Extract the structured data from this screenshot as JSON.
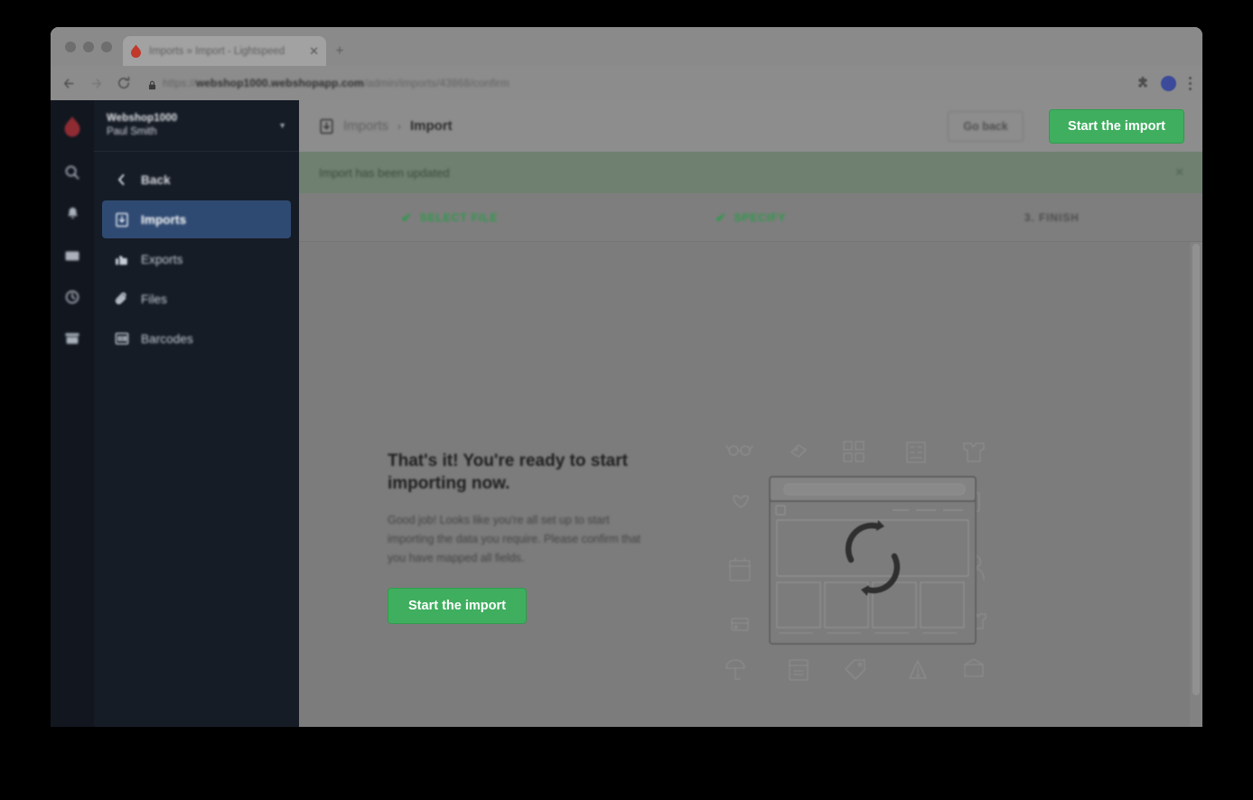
{
  "browser": {
    "tab": {
      "title": "Imports » Import - Lightspeed",
      "favicon_icon": "lightspeed-flame-icon",
      "close_icon": "close-icon"
    },
    "new_tab_label": "+",
    "nav": {
      "back_icon": "arrow-left-icon",
      "forward_icon": "arrow-right-icon",
      "reload_icon": "reload-icon"
    },
    "omnibox": {
      "lock_icon": "lock-icon",
      "url_scheme": "https://",
      "url_host": "webshop1000.webshopapp.com",
      "url_path": "/admin/imports/43868/confirm"
    },
    "toolbar_right": {
      "extension_icon": "puzzle-extension-icon",
      "profile_icon": "profile-avatar-icon",
      "menu_icon": "kebab-menu-icon"
    }
  },
  "sidebar": {
    "logo_icon": "lightspeed-flame-logo",
    "store": {
      "name": "Webshop1000",
      "user": "Paul Smith",
      "caret_icon": "chevron-down-icon"
    },
    "rail_items": [
      {
        "icon": "search-icon"
      },
      {
        "icon": "notification-bell-icon"
      },
      {
        "icon": "inbox-icon"
      },
      {
        "icon": "clock-history-icon"
      },
      {
        "icon": "archive-box-icon"
      }
    ],
    "nav_items": [
      {
        "label": "Back",
        "icon": "chevron-left-icon",
        "active": false
      },
      {
        "label": "Imports",
        "icon": "import-arrow-icon",
        "active": true
      },
      {
        "label": "Exports",
        "icon": "export-arrow-icon",
        "active": false
      },
      {
        "label": "Files",
        "icon": "paperclip-icon",
        "active": false
      },
      {
        "label": "Barcodes",
        "icon": "barcode-icon",
        "active": false
      }
    ]
  },
  "header": {
    "breadcrumb_icon": "import-arrow-icon",
    "breadcrumb_parent": "Imports",
    "breadcrumb_separator": "›",
    "breadcrumb_current": "Import",
    "go_back_label": "Go back",
    "start_import_label": "Start the import"
  },
  "alert": {
    "message": "Import has been updated",
    "close_icon": "close-icon"
  },
  "steps": [
    {
      "label": "SELECT FILE",
      "state": "done",
      "marker": "✔"
    },
    {
      "label": "SPECIFY",
      "state": "done",
      "marker": "✔"
    },
    {
      "label": "3. FINISH",
      "state": "todo",
      "marker": ""
    }
  ],
  "main": {
    "title": "That's it! You're ready to start importing now.",
    "body": "Good job! Looks like you're all set up to start importing the data you require. Please confirm that you have mapped all fields.",
    "start_import_label": "Start the import",
    "illustration_icon": "import-sync-window-illustration"
  },
  "colors": {
    "accent_green": "#3fae5f",
    "sidebar_bg": "#161c26",
    "sidebar_rail_bg": "#12171f",
    "nav_active_bg": "#2f4a72",
    "alert_bg": "#6f8070",
    "step_done": "#2e9a4a",
    "brand_red": "#a02c35"
  }
}
